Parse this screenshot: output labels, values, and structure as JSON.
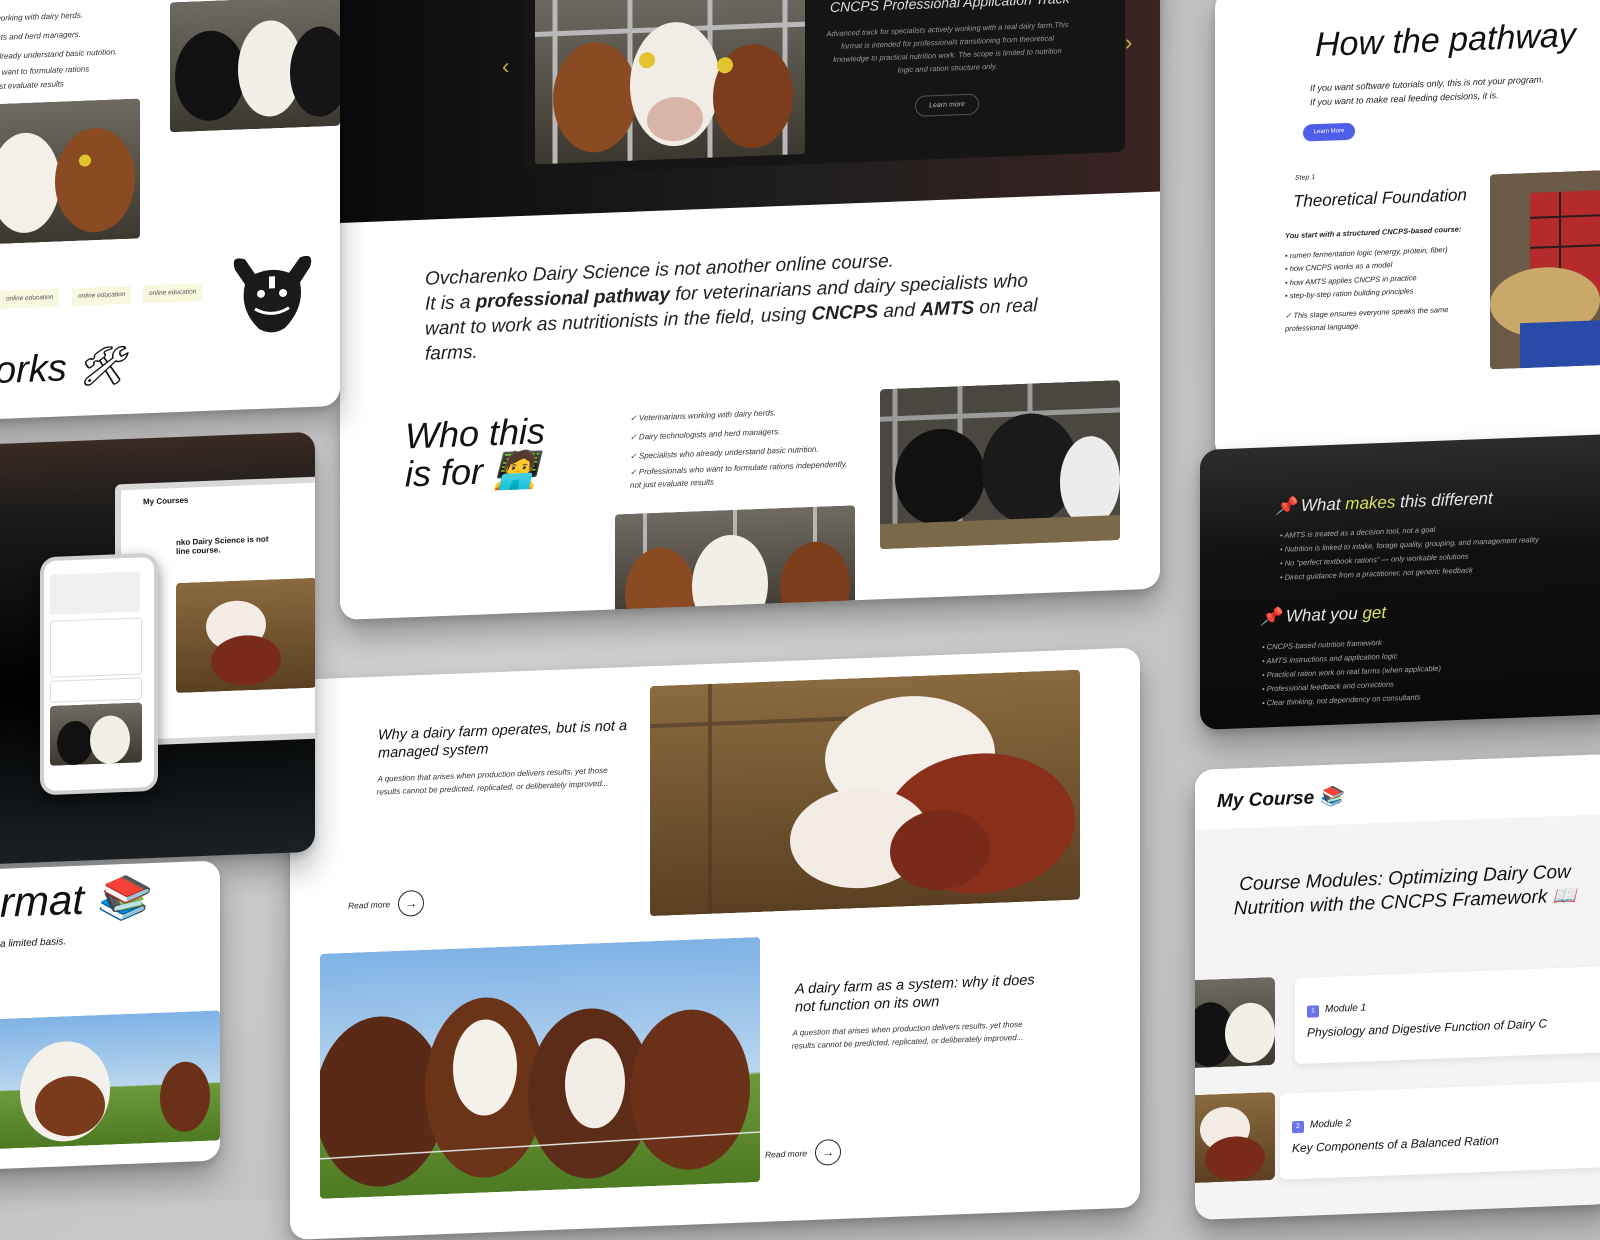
{
  "hero": {
    "title": "CNCPS Professional Application Track",
    "description": "Advanced track for specialists actively working with a real dairy farm.This format is intended for professionals transitioning from theoretical knowledge to practical nutrition work. The scope is limited to nutrition logic and ration structure only.",
    "button": "Learn more",
    "prev": "‹",
    "next": "›"
  },
  "intro": {
    "line1": "Ovcharenko Dairy Science is not another online course.",
    "line2a": "It is a ",
    "line2b": "professional pathway",
    "line2c": " for veterinarians and dairy specialists who want to work as nutritionists in the field, using ",
    "cncps": "CNCPS",
    "and": " and ",
    "amts": "AMTS",
    "end": " on real farms."
  },
  "who": {
    "title_line1": "Who this",
    "title_line2": "is for 🧑‍💻",
    "items": [
      "✓ Veterinarians working with dairy herds.",
      "✓ Dairy technologists and herd managers.",
      "✓ Specialists who already understand basic nutrition.",
      "✓ Professionals who want to formulate rations independently, not just evaluate results"
    ]
  },
  "articles": [
    {
      "title": "Why a dairy farm operates, but is not a managed system",
      "desc": "A question that arises when production delivers results, yet those results cannot be predicted, replicated, or deliberately improved...",
      "read_more": "Read more"
    },
    {
      "title": "A dairy farm as a system: why it does not function on its own",
      "desc": "A question that arises when production delivers results, yet those results cannot be predicted, replicated, or deliberately improved...",
      "read_more": "Read more"
    }
  ],
  "left_top": {
    "items": [
      "working with dairy herds.",
      "ists and herd managers.",
      "already understand basic nutrition.",
      "o want to formulate rations",
      "ust evaluate results"
    ],
    "tags": [
      "online education",
      "online education",
      "online education"
    ],
    "heading": "orks 🛠"
  },
  "left_dark": {
    "tablet_title": "My Courses",
    "tablet_text": "nko Dairy Science is not\nline course."
  },
  "left_bottom": {
    "heading": "rmat 📚",
    "sub": "a limited basis."
  },
  "right_top": {
    "heading": "How the pathway",
    "sub1": "If you want software tutorials only, this is not your program.",
    "sub2": "If you want to make real feeding decisions, it is.",
    "button": "Learn More",
    "step": "Step 1",
    "title": "Theoretical Foundation",
    "lead": "You start with a structured CNCPS-based course:",
    "items": [
      "• rumen fermentation logic (energy, protein, fiber)",
      "• how CNCPS works as a model",
      "• how AMTS applies CNCPS in practice",
      "• step-by-step ration building principles"
    ],
    "note": "✓ This stage ensures everyone speaks the same professional language."
  },
  "right_dark": {
    "h1_pre": "📌 What ",
    "h1_hl": "makes",
    "h1_post": " this different",
    "list1": [
      "• AMTS is treated as a decision tool, not a goal",
      "• Nutrition is linked to intake, forage quality, grouping, and management reality",
      "• No “perfect textbook rations” — only workable solutions",
      "• Direct guidance from a practitioner, not generic feedback"
    ],
    "h2_pre": "📌 What you ",
    "h2_hl": "get",
    "list2": [
      "• CNCPS-based nutrition framework",
      "• AMTS instructions and application logic",
      "• Practical ration work on real farms (when applicable)",
      "• Professional feedback and corrections",
      "• Clear thinking, not dependency on consultants"
    ]
  },
  "course": {
    "header": "My Course 📚",
    "modules_title": "Course Modules: Optimizing Dairy Cow Nutrition with the CNCPS Framework 📖",
    "modules": [
      {
        "num": "1",
        "label": "Module 1",
        "title": "Physiology and Digestive Function of Dairy C"
      },
      {
        "num": "2",
        "label": "Module 2",
        "title": "Key Components of a Balanced Ration"
      }
    ]
  },
  "colors": {
    "accent_blue": "#4f5ee6",
    "highlight_yellow": "#d8e25a",
    "tag_bg": "#f8f8df"
  }
}
